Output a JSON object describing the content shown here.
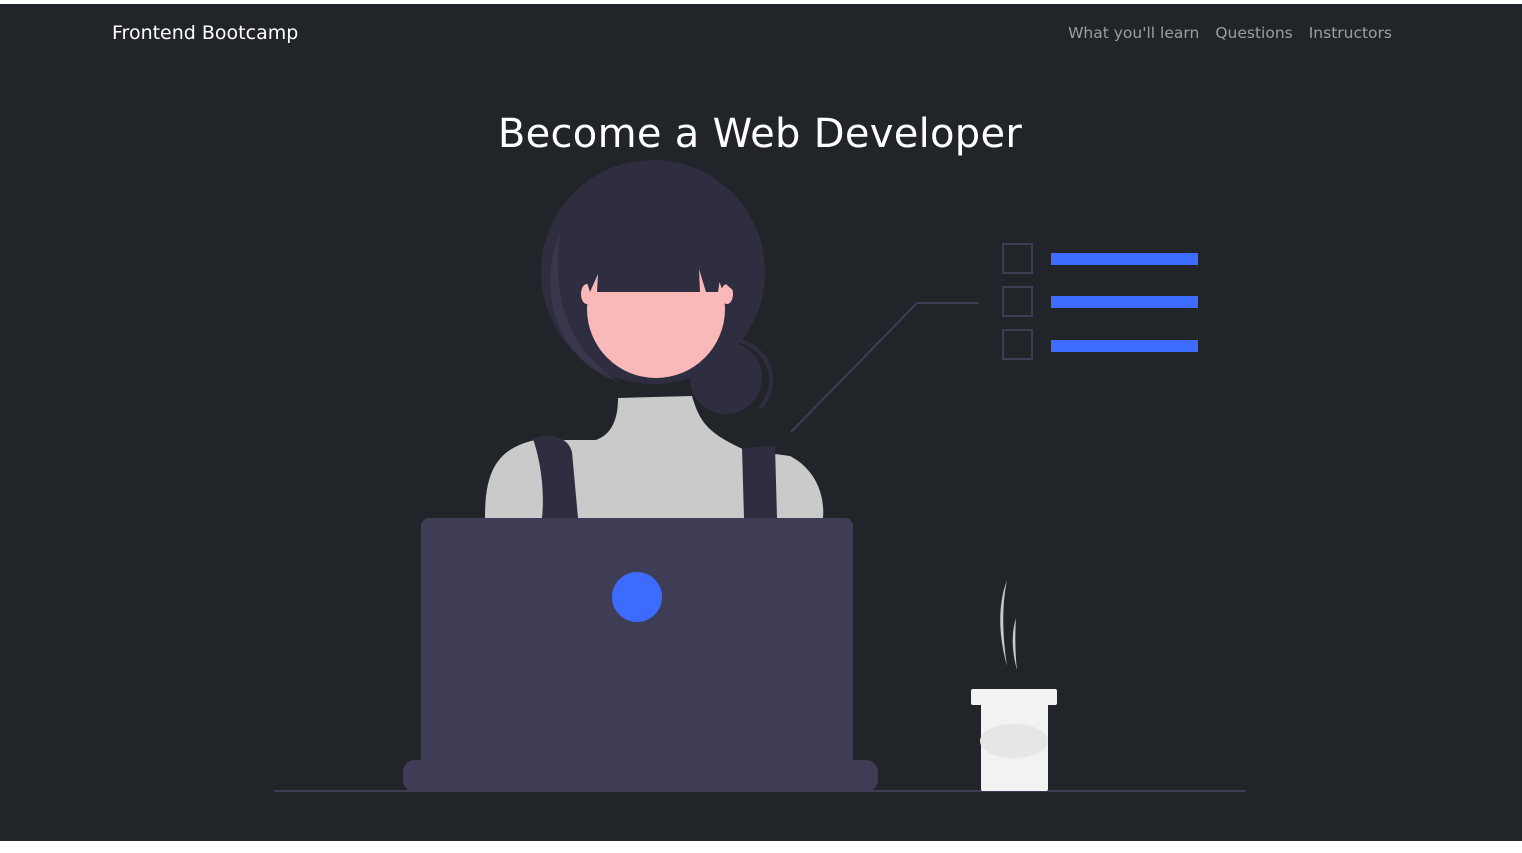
{
  "navbar": {
    "brand": "Frontend Bootcamp",
    "links": [
      {
        "label": "What you'll learn"
      },
      {
        "label": "Questions"
      },
      {
        "label": "Instructors"
      }
    ]
  },
  "hero": {
    "title": "Become a Web Developer",
    "illustration": "woman-at-laptop-illustration"
  },
  "colors": {
    "background": "#212529",
    "accent": "#3d6bfe",
    "hair": "#2f2e41",
    "skin": "#f9b9b8",
    "shirt": "#cacaca",
    "laptop": "#3f3d56"
  }
}
